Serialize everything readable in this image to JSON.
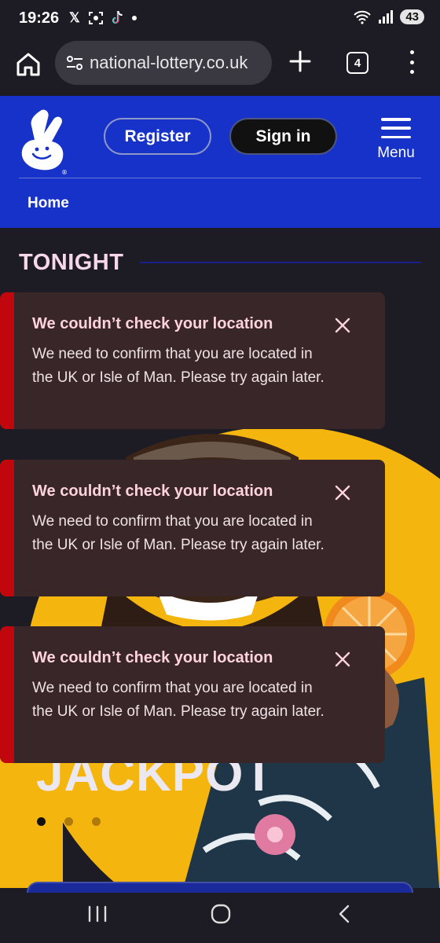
{
  "status": {
    "time": "19:26",
    "battery": "43"
  },
  "browser": {
    "url": "national-lottery.co.uk",
    "tab_count": "4"
  },
  "header": {
    "register_label": "Register",
    "signin_label": "Sign in",
    "menu_label": "Menu",
    "home_link": "Home"
  },
  "section": {
    "title": "TONIGHT"
  },
  "hero": {
    "text": "JACKPOT",
    "slide_count": 3,
    "active_slide": 1
  },
  "toasts": [
    {
      "title": "We couldn’t check your location",
      "message": "We need to confirm that you are located in the UK or Isle of Man. Please try again later."
    },
    {
      "title": "We couldn’t check your location",
      "message": "We need to confirm that you are located in the UK or Isle of Man. Please try again later."
    },
    {
      "title": "We couldn’t check your location",
      "message": "We need to confirm that you are located in the UK or Isle of Man. Please try again later."
    }
  ],
  "colors": {
    "brand_blue": "#1632c8",
    "error_red": "#c1060d",
    "hero_yellow": "#f5b50f",
    "toast_bg": "#382629"
  }
}
